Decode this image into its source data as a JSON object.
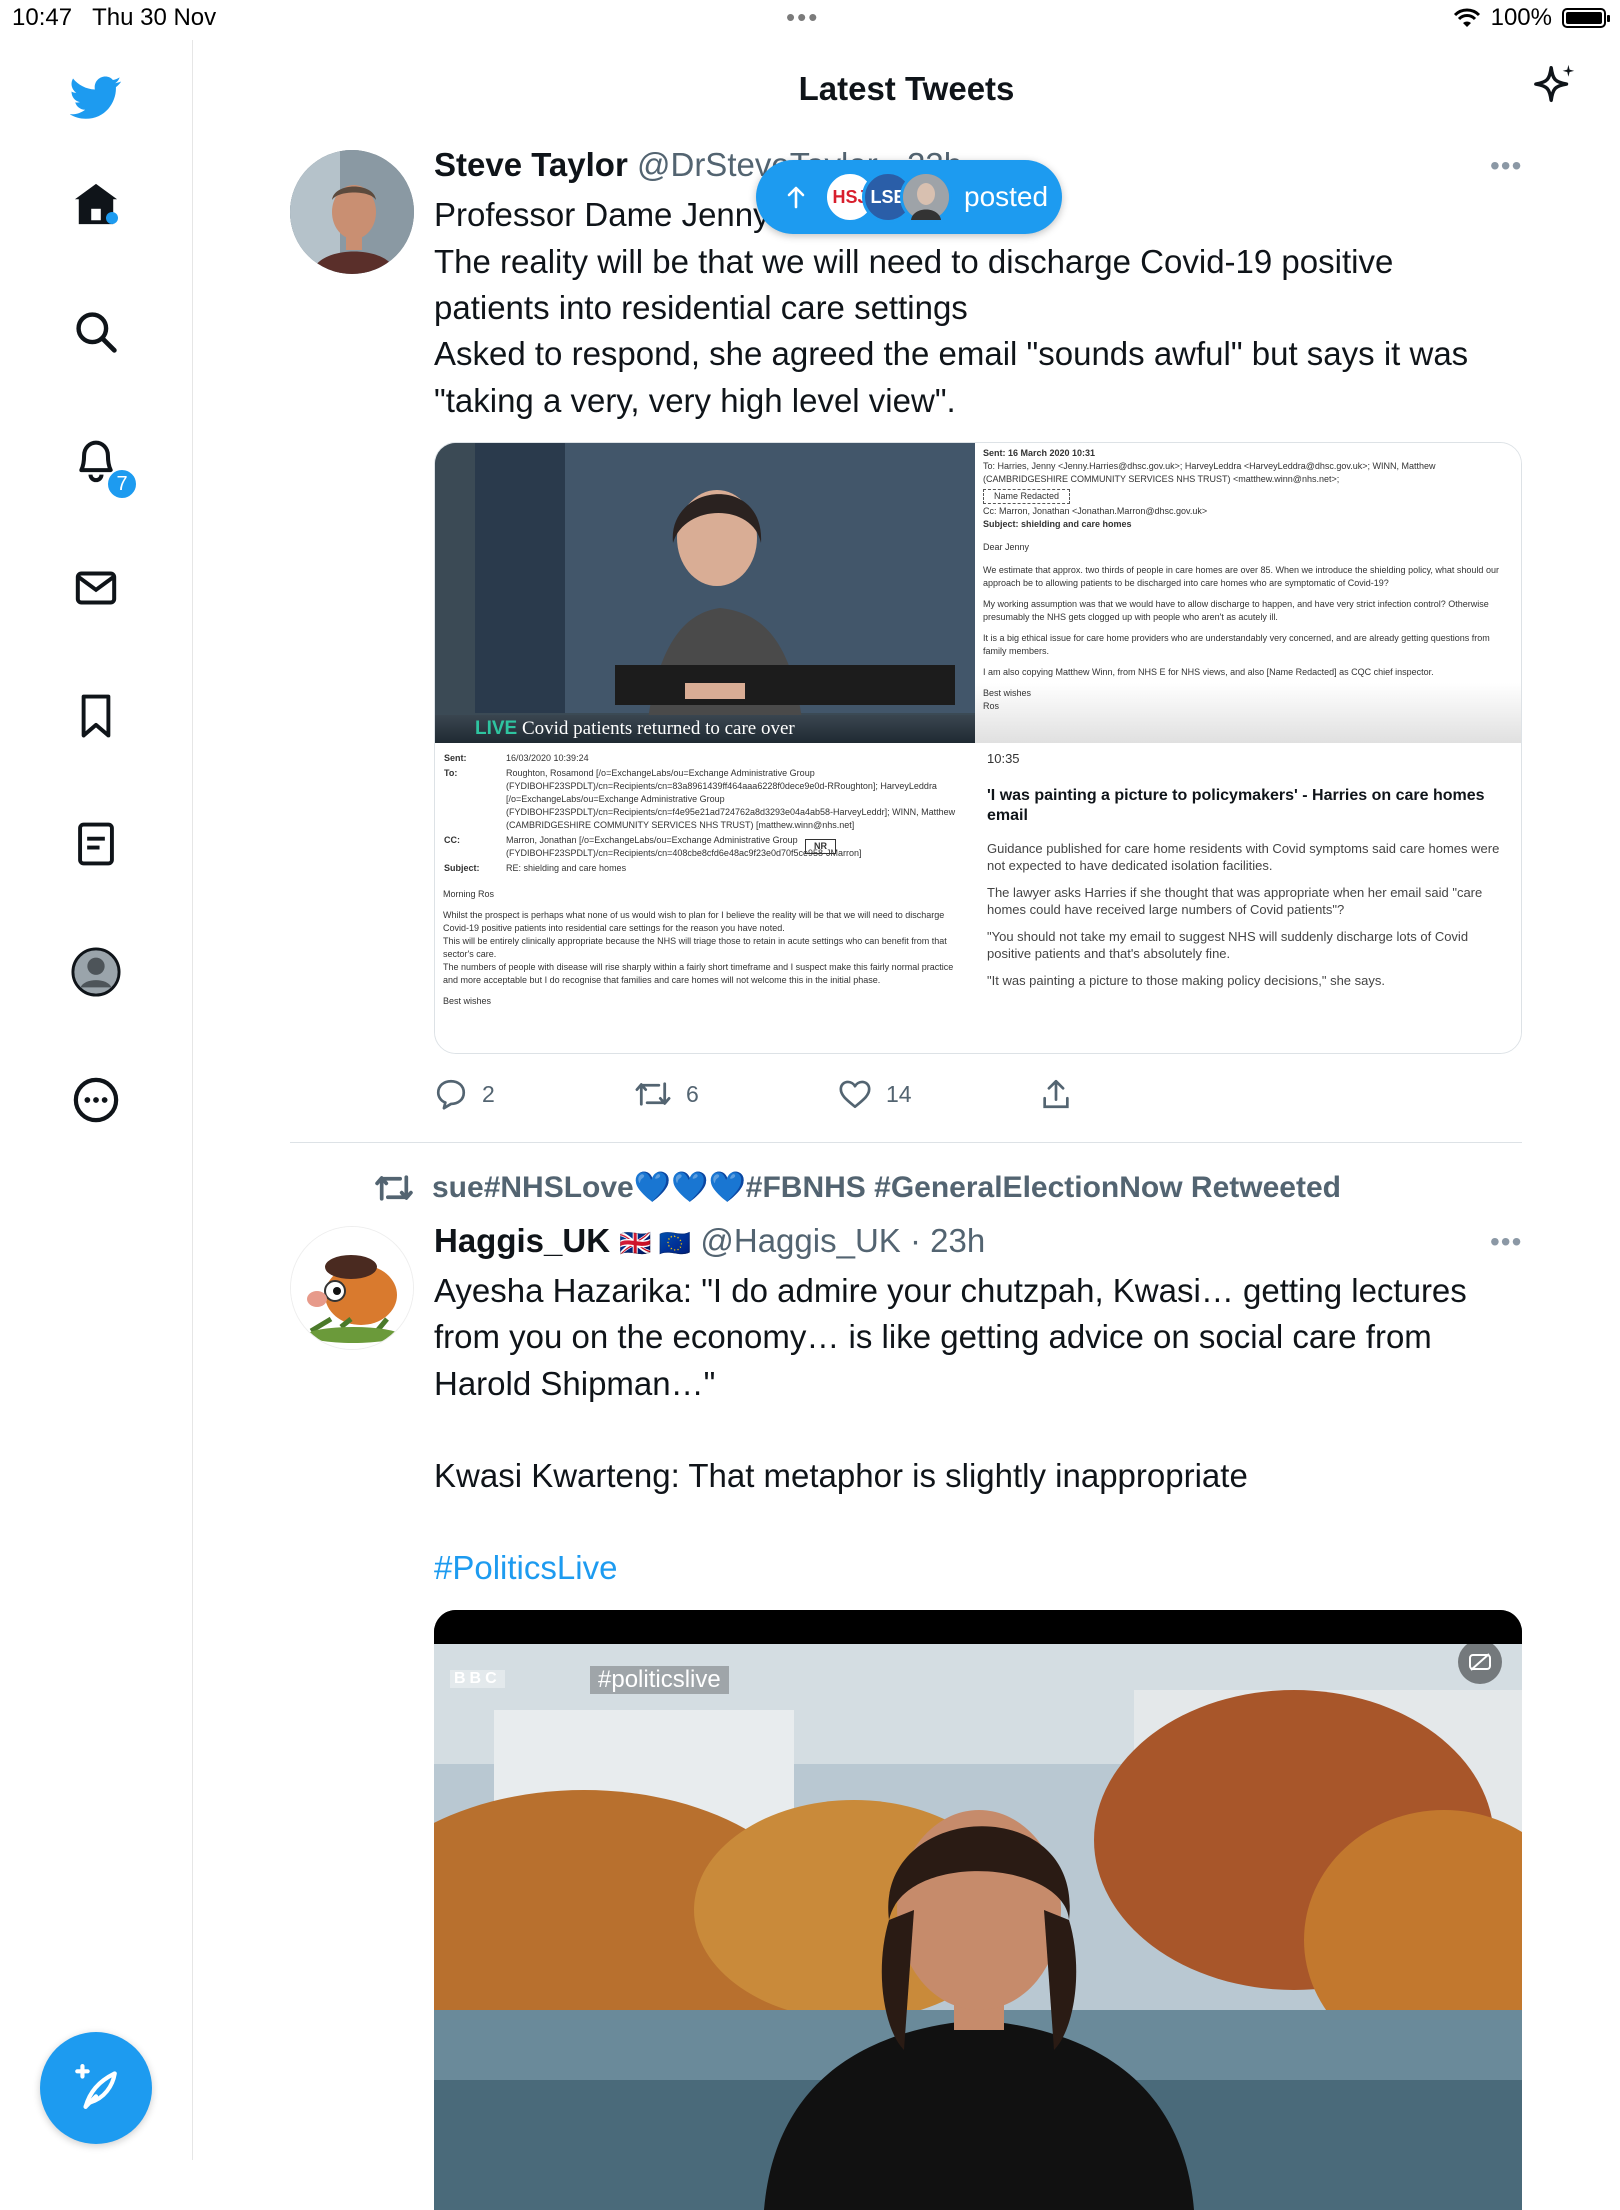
{
  "status_bar": {
    "time": "10:47",
    "date": "Thu 30 Nov",
    "battery": "100%",
    "battery_level": 1.0
  },
  "sidebar": {
    "items": [
      {
        "icon": "twitter-logo-icon"
      },
      {
        "icon": "home-icon"
      },
      {
        "icon": "search-icon"
      },
      {
        "icon": "notifications-icon",
        "badge": "7"
      },
      {
        "icon": "messages-icon"
      },
      {
        "icon": "bookmark-icon"
      },
      {
        "icon": "lists-icon"
      },
      {
        "icon": "profile-icon"
      },
      {
        "icon": "more-icon"
      }
    ],
    "compose_icon": "compose-icon"
  },
  "header": {
    "title": "Latest Tweets",
    "sparkle_icon": "sparkle-icon"
  },
  "posted_pill": {
    "label": "posted",
    "avatars": [
      "HSJ",
      "LSE",
      ""
    ]
  },
  "tweet1": {
    "name": "Steve Taylor",
    "handle": "@DrSteveTaylor · 23h",
    "lines": [
      "Professor Dame Jenny",
      "The reality will be that we will need to discharge Covid-19 positive",
      "patients into residential care settings",
      "Asked to respond, she agreed the email \"sounds awful\" but says it was",
      "\"taking a very, very high level view\"."
    ],
    "media": {
      "live_badge": "LIVE",
      "caption": "Covid patients returned to care over",
      "email_top": {
        "sent": "Sent: 16 March 2020 10:31",
        "to": "To: Harries, Jenny <Jenny.Harries@dhsc.gov.uk>; HarveyLeddra <HarveyLeddra@dhsc.gov.uk>; WINN, Matthew (CAMBRIDGESHIRE COMMUNITY SERVICES NHS TRUST) <matthew.winn@nhs.net>;",
        "name_redacted": "Name Redacted",
        "cc": "Cc: Marron, Jonathan <Jonathan.Marron@dhsc.gov.uk>",
        "subject": "Subject: shielding and care homes",
        "greeting": "Dear Jenny",
        "p1": "We estimate that approx. two thirds of people in care homes are over 85.    When we introduce the shielding policy, what should our approach be to allowing patients to be discharged into care homes who are symptomatic of Covid-19?",
        "p2": "My working assumption was that we would have to allow discharge to happen, and have very strict infection control?  Otherwise presumably the NHS gets clogged up with people who aren't as acutely ill.",
        "p3": "It is a big ethical issue for care home providers who are understandably very concerned, and are already getting questions from family members.",
        "p4": "I am also copying Matthew Winn, from NHS E for NHS views, and also [Name Redacted] as CQC chief inspector.",
        "signoff": "Best wishes",
        "signname": "Ros"
      },
      "email_bottom": {
        "sent_label": "Sent:",
        "sent_value": "16/03/2020 10:39:24",
        "to_label": "To:",
        "to_value": "Roughton, Rosamond [/o=ExchangeLabs/ou=Exchange Administrative Group (FYDIBOHF23SPDLT)/cn=Recipients/cn=83a8961439ff464aaa6228f0dece9e0d-RRoughton]; HarveyLeddra [/o=ExchangeLabs/ou=Exchange Administrative Group (FYDIBOHF23SPDLT)/cn=Recipients/cn=f4e95e21ad724762a8d3293e04a4ab58-HarveyLeddr]; WINN, Matthew (CAMBRIDGESHIRE COMMUNITY SERVICES NHS TRUST) [matthew.winn@nhs.net]",
        "cc_label": "CC:",
        "cc_value": "Marron, Jonathan [/o=ExchangeLabs/ou=Exchange Administrative Group (FYDIBOHF23SPDLT)/cn=Recipients/cn=408cbe8cfd6e48ac9f23e0d70f5ce958-JMarron]",
        "subject_label": "Subject:",
        "subject_value": "RE: shielding and care homes",
        "nr": "NR",
        "greeting": "Morning Ros",
        "p1": "Whilst the prospect is perhaps what none of us would wish to plan for I believe the reality will be that we will need to discharge Covid-19 positive patients into residential care settings for the reason you have noted.",
        "p2": "This will be entirely clinically appropriate because the NHS will triage those to retain in acute settings who can benefit from that sector's care.",
        "p3": "The numbers of people with disease will rise sharply within a fairly short timeframe and I suspect make this fairly normal practice and more acceptable but I do recognise that families and care homes will not welcome this in the initial phase.",
        "signoff": "Best wishes"
      },
      "article": {
        "time": "10:35",
        "headline": "'I was painting a picture to policymakers' - Harries on care homes email",
        "p1": "Guidance published for care home residents with Covid symptoms said care homes were not expected to have dedicated isolation facilities.",
        "p2": "The lawyer asks Harries if she thought that was appropriate when her email said \"care homes could have received large numbers of Covid patients\"?",
        "p3": "\"You should not take my email to suggest NHS will suddenly discharge lots of Covid positive patients and that's absolutely fine.",
        "p4": "\"It was painting a picture to those making policy decisions,\" she says."
      }
    },
    "actions": {
      "replies": "2",
      "retweets": "6",
      "likes": "14"
    }
  },
  "tweet2": {
    "retweeted_by": "sue#NHSLove💙💙💙#FBNHS #GeneralElectionNow Retweeted",
    "name": "Haggis_UK",
    "flags": "🇬🇧 🇪🇺",
    "handle": "@Haggis_UK · 23h",
    "lines": [
      "Ayesha Hazarika: \"I do admire your chutzpah, Kwasi… getting lectures",
      "from you on the economy… is like getting advice on social care from",
      "Harold Shipman…\"",
      "Kwasi Kwarteng: That metaphor is slightly inappropriate"
    ],
    "hashtag": "#PoliticsLive",
    "media": {
      "channel_logo": "BBC",
      "overlay_tag": "#politicslive"
    }
  }
}
